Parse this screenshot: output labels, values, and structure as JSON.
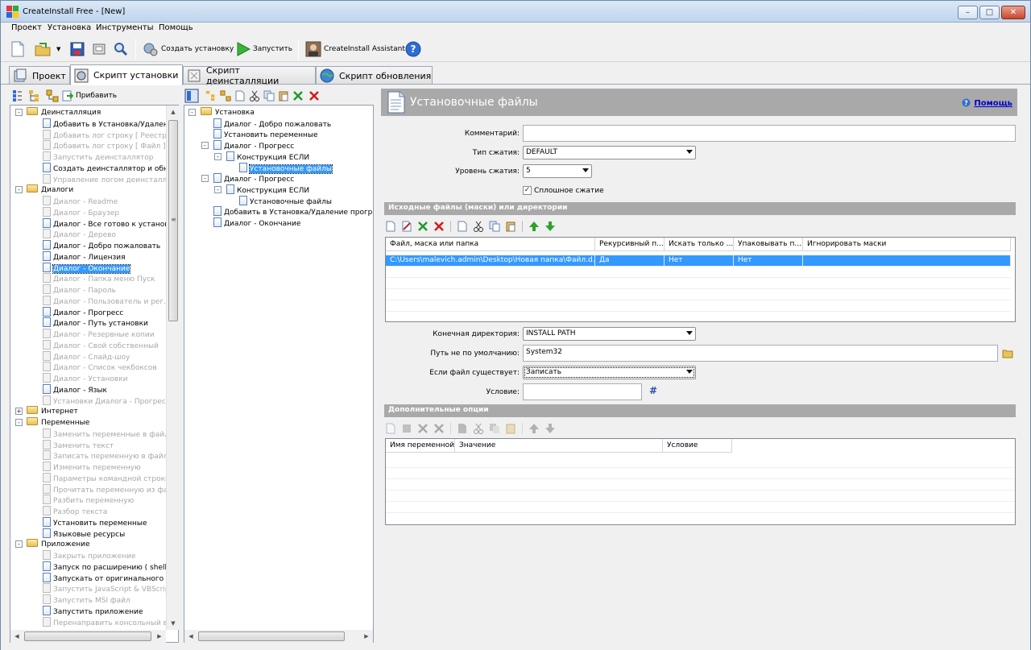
{
  "window": {
    "title": "CreateInstall Free - [New]",
    "min": "–",
    "max": "□",
    "close": "✕"
  },
  "menu": [
    "Проект",
    "Установка",
    "Инструменты",
    "Помощь"
  ],
  "toolbar": {
    "build": "Создать установку",
    "run": "Запустить",
    "assistant": "CreateInstall Assistant"
  },
  "tabs": [
    "Проект",
    "Скрипт установки",
    "Скрипт деинсталляции",
    "Скрипт обновления"
  ],
  "left_panel": {
    "add_label": "Прибавить",
    "items": [
      {
        "t": "Деинсталляция",
        "g": 1,
        "x": "-"
      },
      {
        "t": "Добавить в Установка/Удален"
      },
      {
        "t": "Добавить лог строку [ Реестр ]",
        "d": 1
      },
      {
        "t": "Добавить лог строку [ Файл ]",
        "d": 1
      },
      {
        "t": "Запустить деинсталлятор",
        "d": 1
      },
      {
        "t": "Создать деинсталлятор и обнов"
      },
      {
        "t": "Управление логом деинсталляц",
        "d": 1
      },
      {
        "t": "Диалоги",
        "g": 1,
        "x": "-"
      },
      {
        "t": "Диалог - Readme",
        "d": 1
      },
      {
        "t": "Диалог - Браузер",
        "d": 1
      },
      {
        "t": "Диалог - Все готово к установк"
      },
      {
        "t": "Диалог - Дерево",
        "d": 1
      },
      {
        "t": "Диалог - Добро пожаловать"
      },
      {
        "t": "Диалог - Лицензия"
      },
      {
        "t": "Диалог - Окончание",
        "s": 1
      },
      {
        "t": "Диалог - Папка меню Пуск",
        "d": 1
      },
      {
        "t": "Диалог - Пароль",
        "d": 1
      },
      {
        "t": "Диалог - Пользователь и рег.кл",
        "d": 1
      },
      {
        "t": "Диалог - Прогресс"
      },
      {
        "t": "Диалог - Путь установки"
      },
      {
        "t": "Диалог - Резервные копии",
        "d": 1
      },
      {
        "t": "Диалог - Свой собственный",
        "d": 1
      },
      {
        "t": "Диалог - Слайд-шоу",
        "d": 1
      },
      {
        "t": "Диалог - Список чекбоксов",
        "d": 1
      },
      {
        "t": "Диалог - Установки",
        "d": 1
      },
      {
        "t": "Диалог - Язык"
      },
      {
        "t": "Установки Диалога - Прогресс",
        "d": 1
      },
      {
        "t": "Интернет",
        "g": 1,
        "x": "+"
      },
      {
        "t": "Переменные",
        "g": 1,
        "x": "-"
      },
      {
        "t": "Заменить переменные в файла",
        "d": 1
      },
      {
        "t": "Заменить текст",
        "d": 1
      },
      {
        "t": "Записать переменную в файл",
        "d": 1
      },
      {
        "t": "Изменить переменную",
        "d": 1
      },
      {
        "t": "Параметры командной строки",
        "d": 1
      },
      {
        "t": "Прочитать переменную из файл",
        "d": 1
      },
      {
        "t": "Разбить переменную",
        "d": 1
      },
      {
        "t": "Разбор текста",
        "d": 1
      },
      {
        "t": "Установить переменные"
      },
      {
        "t": "Языковые ресурсы"
      },
      {
        "t": "Приложение",
        "g": 1,
        "x": "-"
      },
      {
        "t": "Закрыть приложение",
        "d": 1
      },
      {
        "t": "Запуск по расширению ( shell )"
      },
      {
        "t": "Запускать от оригинального по"
      },
      {
        "t": "Запустить JavaScript & VBScript",
        "d": 1
      },
      {
        "t": "Запустить MSI файл",
        "d": 1
      },
      {
        "t": "Запустить приложение"
      },
      {
        "t": "Перенаправить консольный вы",
        "d": 1
      }
    ]
  },
  "script_tree": [
    {
      "t": "Установка",
      "lvl": 0,
      "g": 1,
      "x": "-"
    },
    {
      "t": "Диалог - Добро пожаловать",
      "lvl": 1
    },
    {
      "t": "Установить переменные",
      "lvl": 1
    },
    {
      "t": "Диалог - Прогресс",
      "lvl": 1,
      "x": "-"
    },
    {
      "t": "Конструкция ЕСЛИ",
      "lvl": 2,
      "x": "-"
    },
    {
      "t": "Установочные файлы",
      "lvl": 3,
      "s": 1
    },
    {
      "t": "Диалог - Прогресс",
      "lvl": 1,
      "x": "-"
    },
    {
      "t": "Конструкция ЕСЛИ",
      "lvl": 2,
      "x": "-"
    },
    {
      "t": "Установочные файлы",
      "lvl": 3
    },
    {
      "t": "Добавить в Установка/Удаление програ",
      "lvl": 1
    },
    {
      "t": "Диалог - Окончание",
      "lvl": 1
    }
  ],
  "detail": {
    "title": "Установочные файлы",
    "help": "Помощь",
    "comment_label": "Комментарий:",
    "comment_value": "",
    "compress_type_label": "Тип сжатия:",
    "compress_type_value": "DEFAULT",
    "compress_level_label": "Уровень сжатия:",
    "compress_level_value": "5",
    "solid_label": "Сплошное сжатие",
    "solid_checked": true,
    "sources_header": "Исходные файлы (маски) или директории",
    "sources_columns": [
      "Файл, маска или папка",
      "Рекурсивный п...",
      "Искать только ...",
      "Упаковывать п...",
      "Игнорировать маски"
    ],
    "sources_rows": [
      [
        "C:\\Users\\malevich.admin\\Desktop\\Новая папка\\Файл.d...",
        "Да",
        "Нет",
        "Нет",
        ""
      ]
    ],
    "dest_label": "Конечная директория:",
    "dest_value": "INSTALL PATH",
    "default_path_label": "Путь не по умолчанию:",
    "default_path_value": "System32",
    "exists_label": "Если файл существует:",
    "exists_value": "Записать",
    "condition_label": "Условие:",
    "condition_value": "",
    "hash": "#",
    "extra_header": "Дополнительные опции",
    "extra_columns": [
      "Имя переменной",
      "Значение",
      "Условие"
    ]
  },
  "scroll": {
    "up": "▲",
    "down": "▼",
    "left": "◀",
    "right": "▶",
    "grip": "≡"
  },
  "colors": {
    "selection": "#3399ff",
    "header_bar": "#a9a9a9",
    "link": "#0000cc"
  }
}
